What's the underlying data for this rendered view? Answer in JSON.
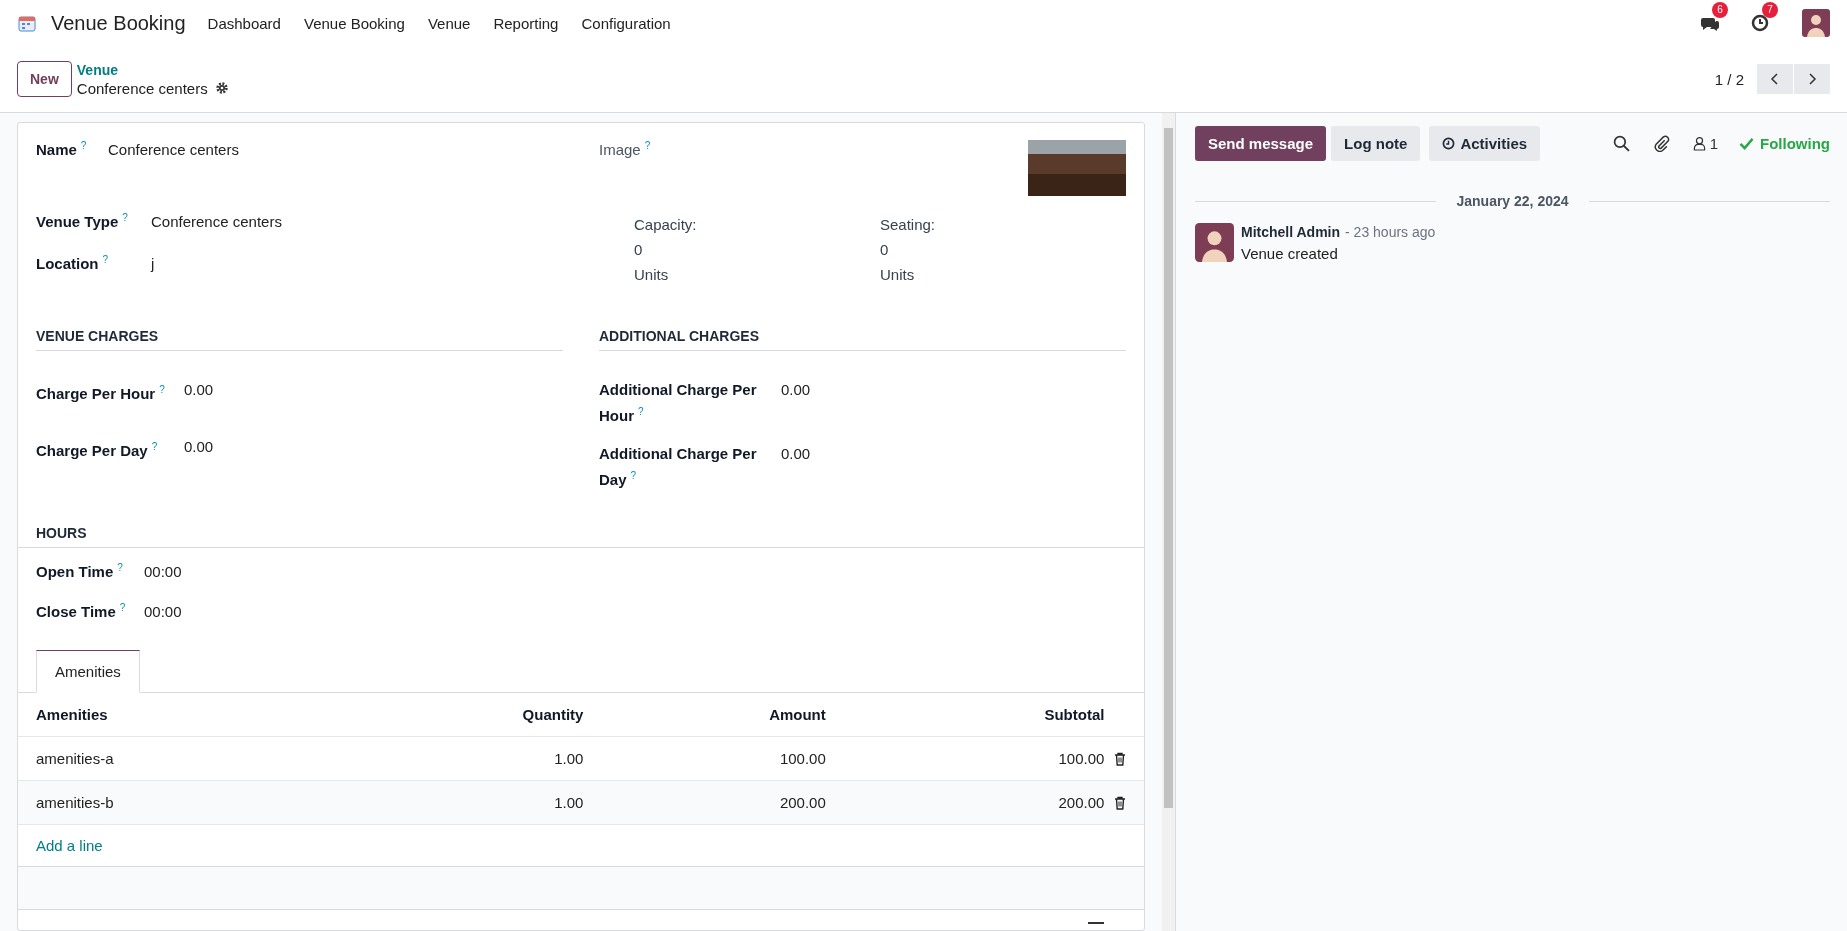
{
  "navbar": {
    "app_name": "Venue Booking",
    "menu": [
      "Dashboard",
      "Venue Booking",
      "Venue",
      "Reporting",
      "Configuration"
    ],
    "messages_badge": "6",
    "activities_badge": "7"
  },
  "control_panel": {
    "new_button": "New",
    "breadcrumb_parent": "Venue",
    "breadcrumb_current": "Conference centers",
    "pager": "1 / 2"
  },
  "form": {
    "name": {
      "label": "Name",
      "help": "?",
      "value": "Conference centers"
    },
    "image": {
      "label": "Image",
      "help": "?"
    },
    "venue_type": {
      "label": "Venue Type",
      "help": "?",
      "value": "Conference centers"
    },
    "location": {
      "label": "Location",
      "help": "?",
      "value": "j"
    },
    "capacity": {
      "label": "Capacity:",
      "value": "0",
      "unit": "Units"
    },
    "seating": {
      "label": "Seating:",
      "value": "0",
      "unit": "Units"
    },
    "venue_charges": {
      "title": "VENUE CHARGES",
      "fields": [
        {
          "label": "Charge Per Hour",
          "help": "?",
          "value": "0.00"
        },
        {
          "label": "Charge Per Day",
          "help": "?",
          "value": "0.00"
        }
      ]
    },
    "additional_charges": {
      "title": "ADDITIONAL CHARGES",
      "fields": [
        {
          "label": "Additional Charge Per Hour",
          "help": "?",
          "value": "0.00"
        },
        {
          "label": "Additional Charge Per Day",
          "help": "?",
          "value": "0.00"
        }
      ]
    },
    "hours": {
      "title": "HOURS",
      "fields": [
        {
          "label": "Open Time",
          "help": "?",
          "value": "00:00"
        },
        {
          "label": "Close Time",
          "help": "?",
          "value": "00:00"
        }
      ]
    },
    "tabs": [
      {
        "label": "Amenities",
        "selected": true
      }
    ],
    "table": {
      "columns": [
        "Amenities",
        "Quantity",
        "Amount",
        "Subtotal"
      ],
      "rows": [
        {
          "cells": [
            "amenities-a",
            "1.00",
            "100.00",
            "100.00"
          ]
        },
        {
          "cells": [
            "amenities-b",
            "1.00",
            "200.00",
            "200.00"
          ]
        }
      ],
      "add_line": "Add a line"
    }
  },
  "chatter": {
    "buttons": [
      {
        "label": "Send message",
        "selected": true
      },
      {
        "label": "Log note",
        "selected": false
      },
      {
        "label": "Activities",
        "selected": false
      }
    ],
    "follower_count": "1",
    "following": "Following",
    "date": "January 22, 2024",
    "messages": [
      {
        "author": "Mitchell Admin",
        "time": "- 23 hours ago",
        "body": "Venue created"
      }
    ]
  }
}
